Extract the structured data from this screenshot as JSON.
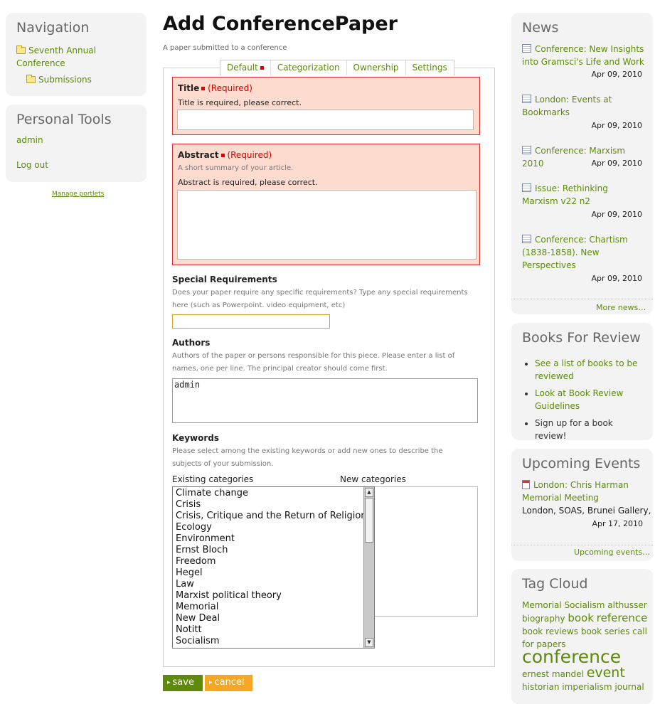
{
  "navigation": {
    "title": "Navigation",
    "items": [
      {
        "label": "Seventh Annual Conference"
      },
      {
        "label": "Submissions"
      }
    ]
  },
  "personal_tools": {
    "title": "Personal Tools",
    "items": [
      {
        "label": "admin"
      },
      {
        "label": "Log out"
      }
    ]
  },
  "manage_portlets": "Manage portlets",
  "page": {
    "title": "Add ConferencePaper",
    "subtitle": "A paper submitted to a conference"
  },
  "tabs": [
    {
      "label": "Default"
    },
    {
      "label": "Categorization"
    },
    {
      "label": "Ownership"
    },
    {
      "label": "Settings"
    }
  ],
  "fields": {
    "title": {
      "label": "Title",
      "required": "(Required)",
      "error": "Title is required, please correct.",
      "value": ""
    },
    "abstract": {
      "label": "Abstract",
      "required": "(Required)",
      "help": "A short summary of your article.",
      "error": "Abstract is required, please correct.",
      "value": ""
    },
    "special_requirements": {
      "label": "Special Requirements",
      "help": "Does your paper require any specific requirements? Type any special requirements here (such as Powerpoint. video equipment, etc)",
      "value": ""
    },
    "authors": {
      "label": "Authors",
      "help": "Authors of the paper or persons responsible for this piece. Please enter a list of names, one per line. The principal creator should come first.",
      "value": "admin"
    },
    "keywords": {
      "label": "Keywords",
      "help": "Please select among the existing keywords or add new ones to describe the subjects of your submission.",
      "existing_label": "Existing categories",
      "new_label": "New categories",
      "options": [
        "Climate change",
        "Crisis",
        "Crisis, Critique and the Return of Religion",
        "Ecology",
        "Environment",
        "Ernst Bloch",
        "Freedom",
        "Hegel",
        "Law",
        "Marxist political theory",
        "Memorial",
        "New Deal",
        "Notitt",
        "Socialism"
      ]
    }
  },
  "buttons": {
    "save": "save",
    "cancel": "cancel"
  },
  "news": {
    "title": "News",
    "items": [
      {
        "label": "Conference: New Insights into Gramsci's Life and Work",
        "date": "Apr 09, 2010"
      },
      {
        "label": "London: Events at Bookmarks",
        "date": "Apr 09, 2010"
      },
      {
        "label": "Conference: Marxism 2010",
        "date": "Apr 09, 2010"
      },
      {
        "label": "Issue: Rethinking Marxism v22 n2",
        "date": "Apr 09, 2010"
      },
      {
        "label": "Conference: Chartism (1838-1858). New Perspectives",
        "date": "Apr 09, 2010"
      }
    ],
    "more": "More news…"
  },
  "books": {
    "title": "Books For Review",
    "items": [
      {
        "label": "See a list of books to be reviewed"
      },
      {
        "label": "Look at Book Review Guidelines"
      },
      {
        "label": "Sign up for a book review!"
      }
    ]
  },
  "events": {
    "title": "Upcoming Events",
    "item": {
      "label": "London: Chris Harman Memorial Meeting",
      "location": "London, SOAS, Brunei Gallery,",
      "date": "Apr 17, 2010"
    },
    "more": "Upcoming events…"
  },
  "tagcloud": {
    "title": "Tag Cloud",
    "tags": [
      {
        "label": "Memorial",
        "size": "s"
      },
      {
        "label": "Socialism",
        "size": "s"
      },
      {
        "label": "althusser",
        "size": "s"
      },
      {
        "label": "biography",
        "size": "s"
      },
      {
        "label": "book",
        "size": "m"
      },
      {
        "label": "reference",
        "size": "m"
      },
      {
        "label": "book reviews",
        "size": "s"
      },
      {
        "label": "book series",
        "size": "s"
      },
      {
        "label": "call for papers",
        "size": "s"
      },
      {
        "label": "conference",
        "size": "xl"
      },
      {
        "label": "ernest mandel",
        "size": "s"
      },
      {
        "label": "event",
        "size": "l"
      },
      {
        "label": "historian",
        "size": "s"
      },
      {
        "label": "imperialism",
        "size": "s"
      },
      {
        "label": "journal",
        "size": "s"
      }
    ]
  }
}
